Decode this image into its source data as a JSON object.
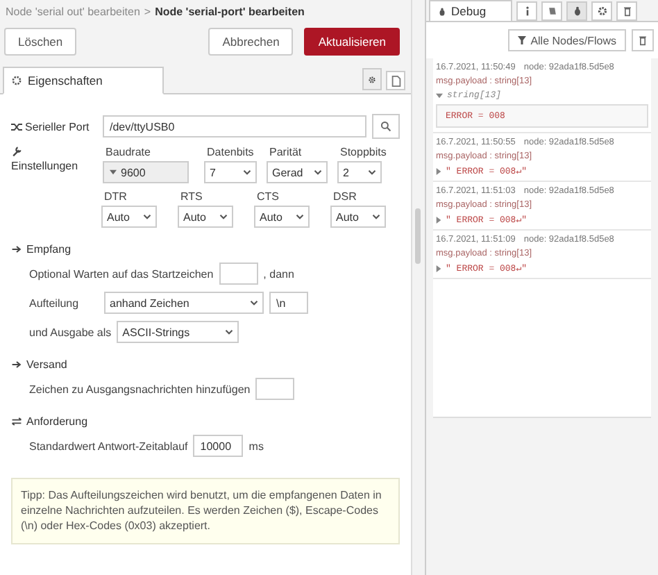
{
  "breadcrumb": {
    "parent": "Node 'serial out' bearbeiten",
    "separator": ">",
    "current": "Node 'serial-port' bearbeiten"
  },
  "buttons": {
    "delete": "Löschen",
    "cancel": "Abbrechen",
    "update": "Aktualisieren"
  },
  "tabs": [
    {
      "label": "Eigenschaften",
      "selected": true
    }
  ],
  "form": {
    "port": {
      "label": "Serieller Port",
      "value": "/dev/ttyUSB0"
    },
    "settings": {
      "label": "Einstellungen",
      "baud": {
        "label": "Baudrate",
        "value": "9600"
      },
      "databits": {
        "label": "Datenbits",
        "value": "7"
      },
      "parity": {
        "label": "Parität",
        "value": "Gerad"
      },
      "stopbits": {
        "label": "Stoppbits",
        "value": "2"
      },
      "lines": [
        {
          "label": "DTR",
          "value": "Auto"
        },
        {
          "label": "RTS",
          "value": "Auto"
        },
        {
          "label": "CTS",
          "value": "Auto"
        },
        {
          "label": "DSR",
          "value": "Auto"
        }
      ]
    },
    "receive": {
      "heading": "Empfang",
      "wait_label": "Optional Warten auf das Startzeichen",
      "wait_suffix": ", dann",
      "split_label": "Aufteilung",
      "split_value": "anhand Zeichen",
      "split_char": "\\n",
      "output_label": "und Ausgabe als",
      "output_value": "ASCII-Strings"
    },
    "send": {
      "heading": "Versand",
      "add_label": "Zeichen zu Ausgangsnachrichten hinzufügen"
    },
    "request": {
      "heading": "Anforderung",
      "timeout_label": "Standardwert Antwort-Zeitablauf",
      "timeout_value": "10000",
      "unit": "ms"
    },
    "tip": "Tipp: Das Aufteilungszeichen wird benutzt, um die empfangenen Daten in einzelne Nachrichten aufzuteilen. Es werden Zeichen ($), Escape-Codes (\\n) oder Hex-Codes (0x03) akzeptiert."
  },
  "debug": {
    "tab": "Debug",
    "filter": "Alle Nodes/Flows",
    "messages": [
      {
        "time": "16.7.2021, 11:50:49",
        "node": "node: 92ada1f8.5d5e8",
        "topic": "msg.payload : string[13]",
        "expanded": true,
        "type_label": "string[13]",
        "value": "ERROR = 008"
      },
      {
        "time": "16.7.2021, 11:50:55",
        "node": "node: 92ada1f8.5d5e8",
        "topic": "msg.payload : string[13]",
        "expanded": false,
        "value": "\" ERROR = 008↵\""
      },
      {
        "time": "16.7.2021, 11:51:03",
        "node": "node: 92ada1f8.5d5e8",
        "topic": "msg.payload : string[13]",
        "expanded": false,
        "value": "\" ERROR = 008↵\""
      },
      {
        "time": "16.7.2021, 11:51:09",
        "node": "node: 92ada1f8.5d5e8",
        "topic": "msg.payload : string[13]",
        "expanded": false,
        "value": "\" ERROR = 008↵\""
      }
    ]
  }
}
